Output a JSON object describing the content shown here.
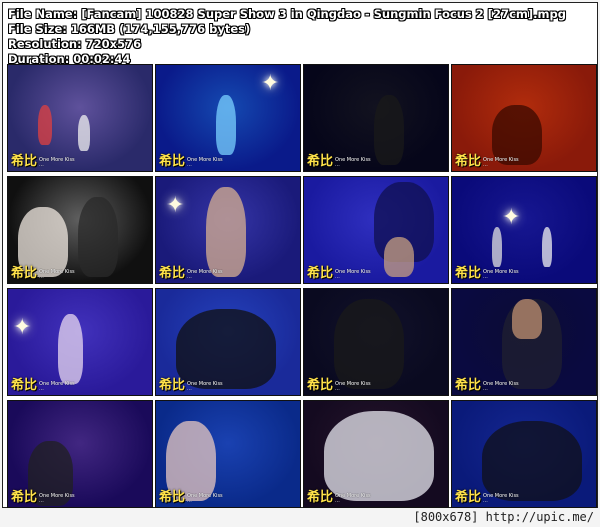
{
  "header": {
    "file_name": "File Name: [Fancam] 100828 Super Show 3 in Qingdao - Sungmin Focus 2 [27cm].mpg",
    "file_size": "File Size: 166MB (174,155,776 bytes)",
    "resolution": "Resolution: 720x576",
    "duration": "Duration: 00:02:44"
  },
  "thumbnail_watermark": {
    "glyph": "希比",
    "text_line1": "One More Kiss",
    "text_line2": "..."
  },
  "footer": {
    "link_text": "[800x678] http://upic.me/"
  },
  "thumbnails": [
    {
      "bg": "#2a2a6a",
      "accent": "#c8a0ff"
    },
    {
      "bg": "#0a1a8a",
      "accent": "#2aa8ff"
    },
    {
      "bg": "#06061a",
      "accent": "#2a2a2a"
    },
    {
      "bg": "#8a1a0a",
      "accent": "#ff5010"
    },
    {
      "bg": "#101010",
      "accent": "#ffffff"
    },
    {
      "bg": "#1a1a7a",
      "accent": "#6a6aff"
    },
    {
      "bg": "#1a1aa0",
      "accent": "#5a5aff"
    },
    {
      "bg": "#0a0a7a",
      "accent": "#3030c0"
    },
    {
      "bg": "#2a1a9a",
      "accent": "#7060ff"
    },
    {
      "bg": "#1a2a9a",
      "accent": "#3a70ff"
    },
    {
      "bg": "#0a0a20",
      "accent": "#202040"
    },
    {
      "bg": "#0a0a40",
      "accent": "#101020"
    },
    {
      "bg": "#1a0a5a",
      "accent": "#9060d0"
    },
    {
      "bg": "#0a2a8a",
      "accent": "#3a70ff"
    },
    {
      "bg": "#140a20",
      "accent": "#4a2a40"
    },
    {
      "bg": "#0a1a7a",
      "accent": "#2a40c0"
    }
  ]
}
